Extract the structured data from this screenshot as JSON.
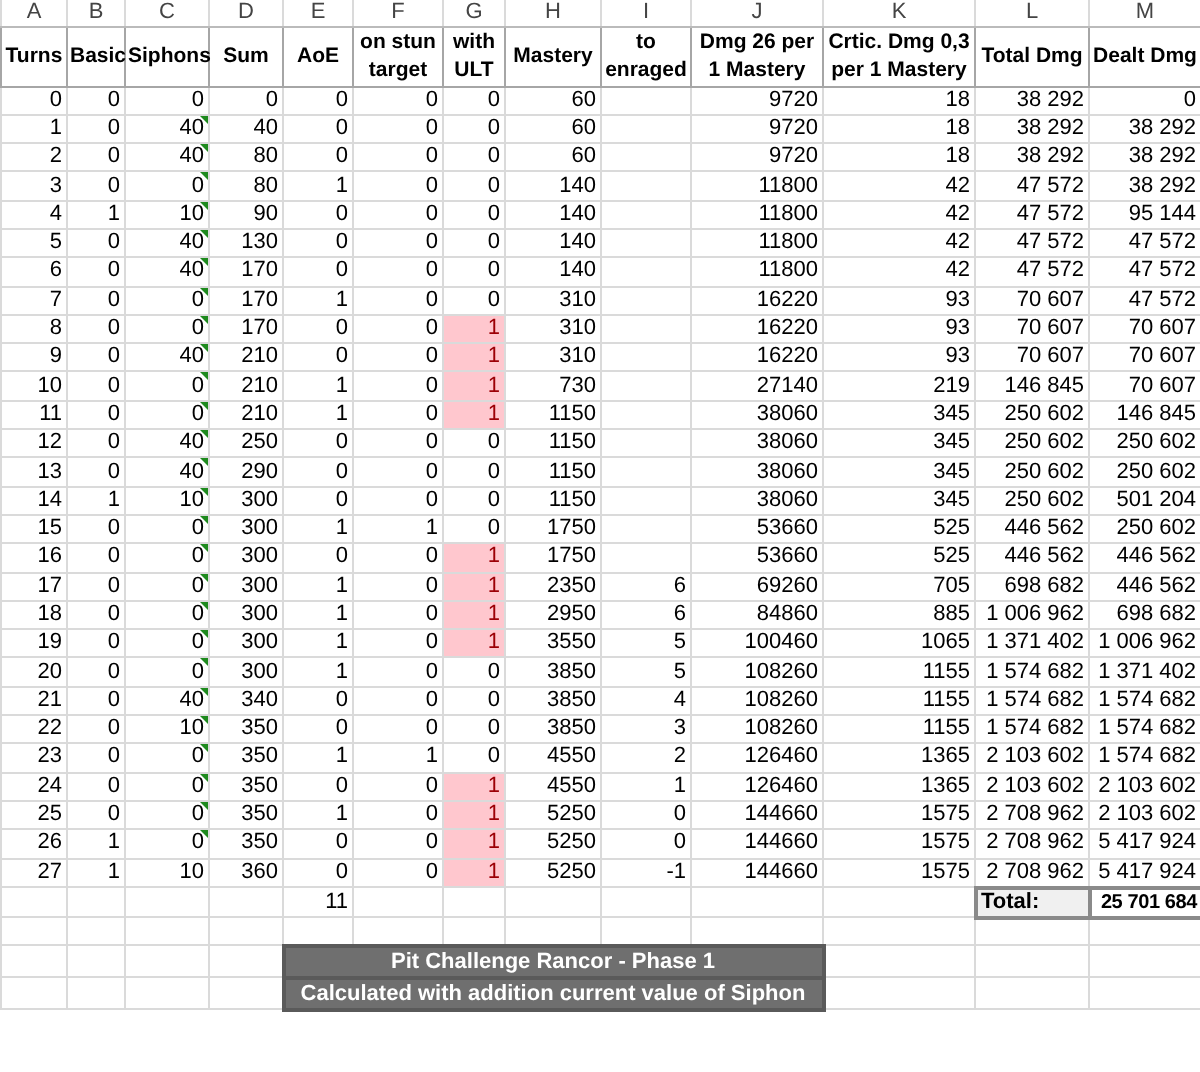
{
  "column_letters": [
    "A",
    "B",
    "C",
    "D",
    "E",
    "F",
    "G",
    "H",
    "I",
    "J",
    "K",
    "L",
    "M"
  ],
  "headers": [
    "Turns",
    "Basic",
    "Siphons",
    "Sum",
    "AoE",
    "on stun target",
    "with ULT",
    "Mastery",
    "to enraged",
    "Dmg 26 per 1 Mastery",
    "Crtic. Dmg 0,3 per 1 Mastery",
    "Total Dmg",
    "Dealt Dmg"
  ],
  "rows": [
    {
      "cells": [
        "0",
        "0",
        "0",
        "0",
        "0",
        "0",
        "0",
        "60",
        null,
        "9720",
        "18",
        "38 292",
        "0"
      ],
      "ult_highlight": false,
      "siphon_flag": false
    },
    {
      "cells": [
        "1",
        "0",
        "40",
        "40",
        "0",
        "0",
        "0",
        "60",
        null,
        "9720",
        "18",
        "38 292",
        "38 292"
      ],
      "ult_highlight": false,
      "siphon_flag": true
    },
    {
      "cells": [
        "2",
        "0",
        "40",
        "80",
        "0",
        "0",
        "0",
        "60",
        null,
        "9720",
        "18",
        "38 292",
        "38 292"
      ],
      "ult_highlight": false,
      "siphon_flag": true
    },
    {
      "cells": [
        "3",
        "0",
        "0",
        "80",
        "1",
        "0",
        "0",
        "140",
        null,
        "11800",
        "42",
        "47 572",
        "38 292"
      ],
      "ult_highlight": false,
      "siphon_flag": true
    },
    {
      "cells": [
        "4",
        "1",
        "10",
        "90",
        "0",
        "0",
        "0",
        "140",
        null,
        "11800",
        "42",
        "47 572",
        "95 144"
      ],
      "ult_highlight": false,
      "siphon_flag": true
    },
    {
      "cells": [
        "5",
        "0",
        "40",
        "130",
        "0",
        "0",
        "0",
        "140",
        null,
        "11800",
        "42",
        "47 572",
        "47 572"
      ],
      "ult_highlight": false,
      "siphon_flag": true
    },
    {
      "cells": [
        "6",
        "0",
        "40",
        "170",
        "0",
        "0",
        "0",
        "140",
        null,
        "11800",
        "42",
        "47 572",
        "47 572"
      ],
      "ult_highlight": false,
      "siphon_flag": true
    },
    {
      "cells": [
        "7",
        "0",
        "0",
        "170",
        "1",
        "0",
        "0",
        "310",
        null,
        "16220",
        "93",
        "70 607",
        "47 572"
      ],
      "ult_highlight": false,
      "siphon_flag": true
    },
    {
      "cells": [
        "8",
        "0",
        "0",
        "170",
        "0",
        "0",
        "1",
        "310",
        null,
        "16220",
        "93",
        "70 607",
        "70 607"
      ],
      "ult_highlight": true,
      "siphon_flag": true
    },
    {
      "cells": [
        "9",
        "0",
        "40",
        "210",
        "0",
        "0",
        "1",
        "310",
        null,
        "16220",
        "93",
        "70 607",
        "70 607"
      ],
      "ult_highlight": true,
      "siphon_flag": true
    },
    {
      "cells": [
        "10",
        "0",
        "0",
        "210",
        "1",
        "0",
        "1",
        "730",
        null,
        "27140",
        "219",
        "146 845",
        "70 607"
      ],
      "ult_highlight": true,
      "siphon_flag": true
    },
    {
      "cells": [
        "11",
        "0",
        "0",
        "210",
        "1",
        "0",
        "1",
        "1150",
        null,
        "38060",
        "345",
        "250 602",
        "146 845"
      ],
      "ult_highlight": true,
      "siphon_flag": true
    },
    {
      "cells": [
        "12",
        "0",
        "40",
        "250",
        "0",
        "0",
        "0",
        "1150",
        null,
        "38060",
        "345",
        "250 602",
        "250 602"
      ],
      "ult_highlight": false,
      "siphon_flag": true
    },
    {
      "cells": [
        "13",
        "0",
        "40",
        "290",
        "0",
        "0",
        "0",
        "1150",
        null,
        "38060",
        "345",
        "250 602",
        "250 602"
      ],
      "ult_highlight": false,
      "siphon_flag": true
    },
    {
      "cells": [
        "14",
        "1",
        "10",
        "300",
        "0",
        "0",
        "0",
        "1150",
        null,
        "38060",
        "345",
        "250 602",
        "501 204"
      ],
      "ult_highlight": false,
      "siphon_flag": true
    },
    {
      "cells": [
        "15",
        "0",
        "0",
        "300",
        "1",
        "1",
        "0",
        "1750",
        null,
        "53660",
        "525",
        "446 562",
        "250 602"
      ],
      "ult_highlight": false,
      "siphon_flag": true
    },
    {
      "cells": [
        "16",
        "0",
        "0",
        "300",
        "0",
        "0",
        "1",
        "1750",
        null,
        "53660",
        "525",
        "446 562",
        "446 562"
      ],
      "ult_highlight": true,
      "siphon_flag": true
    },
    {
      "cells": [
        "17",
        "0",
        "0",
        "300",
        "1",
        "0",
        "1",
        "2350",
        "6",
        "69260",
        "705",
        "698 682",
        "446 562"
      ],
      "ult_highlight": true,
      "siphon_flag": true
    },
    {
      "cells": [
        "18",
        "0",
        "0",
        "300",
        "1",
        "0",
        "1",
        "2950",
        "6",
        "84860",
        "885",
        "1 006 962",
        "698 682"
      ],
      "ult_highlight": true,
      "siphon_flag": true
    },
    {
      "cells": [
        "19",
        "0",
        "0",
        "300",
        "1",
        "0",
        "1",
        "3550",
        "5",
        "100460",
        "1065",
        "1 371 402",
        "1 006 962"
      ],
      "ult_highlight": true,
      "siphon_flag": true
    },
    {
      "cells": [
        "20",
        "0",
        "0",
        "300",
        "1",
        "0",
        "0",
        "3850",
        "5",
        "108260",
        "1155",
        "1 574 682",
        "1 371 402"
      ],
      "ult_highlight": false,
      "siphon_flag": true
    },
    {
      "cells": [
        "21",
        "0",
        "40",
        "340",
        "0",
        "0",
        "0",
        "3850",
        "4",
        "108260",
        "1155",
        "1 574 682",
        "1 574 682"
      ],
      "ult_highlight": false,
      "siphon_flag": true
    },
    {
      "cells": [
        "22",
        "0",
        "10",
        "350",
        "0",
        "0",
        "0",
        "3850",
        "3",
        "108260",
        "1155",
        "1 574 682",
        "1 574 682"
      ],
      "ult_highlight": false,
      "siphon_flag": true
    },
    {
      "cells": [
        "23",
        "0",
        "0",
        "350",
        "1",
        "1",
        "0",
        "4550",
        "2",
        "126460",
        "1365",
        "2 103 602",
        "1 574 682"
      ],
      "ult_highlight": false,
      "siphon_flag": true
    },
    {
      "cells": [
        "24",
        "0",
        "0",
        "350",
        "0",
        "0",
        "1",
        "4550",
        "1",
        "126460",
        "1365",
        "2 103 602",
        "2 103 602"
      ],
      "ult_highlight": true,
      "siphon_flag": true
    },
    {
      "cells": [
        "25",
        "0",
        "0",
        "350",
        "1",
        "0",
        "1",
        "5250",
        "0",
        "144660",
        "1575",
        "2 708 962",
        "2 103 602"
      ],
      "ult_highlight": true,
      "siphon_flag": true
    },
    {
      "cells": [
        "26",
        "1",
        "0",
        "350",
        "0",
        "0",
        "1",
        "5250",
        "0",
        "144660",
        "1575",
        "2 708 962",
        "5 417 924"
      ],
      "ult_highlight": true,
      "siphon_flag": true
    },
    {
      "cells": [
        "27",
        "1",
        "10",
        "360",
        "0",
        "0",
        "1",
        "5250",
        "-1",
        "144660",
        "1575",
        "2 708 962",
        "5 417 924"
      ],
      "ult_highlight": true,
      "siphon_flag": false
    }
  ],
  "aoe_count": "11",
  "total": {
    "label": "Total:",
    "value": "25 701 684"
  },
  "banners": [
    "Pit Challenge Rancor - Phase 1",
    "Calculated with addition current value of Siphon"
  ]
}
